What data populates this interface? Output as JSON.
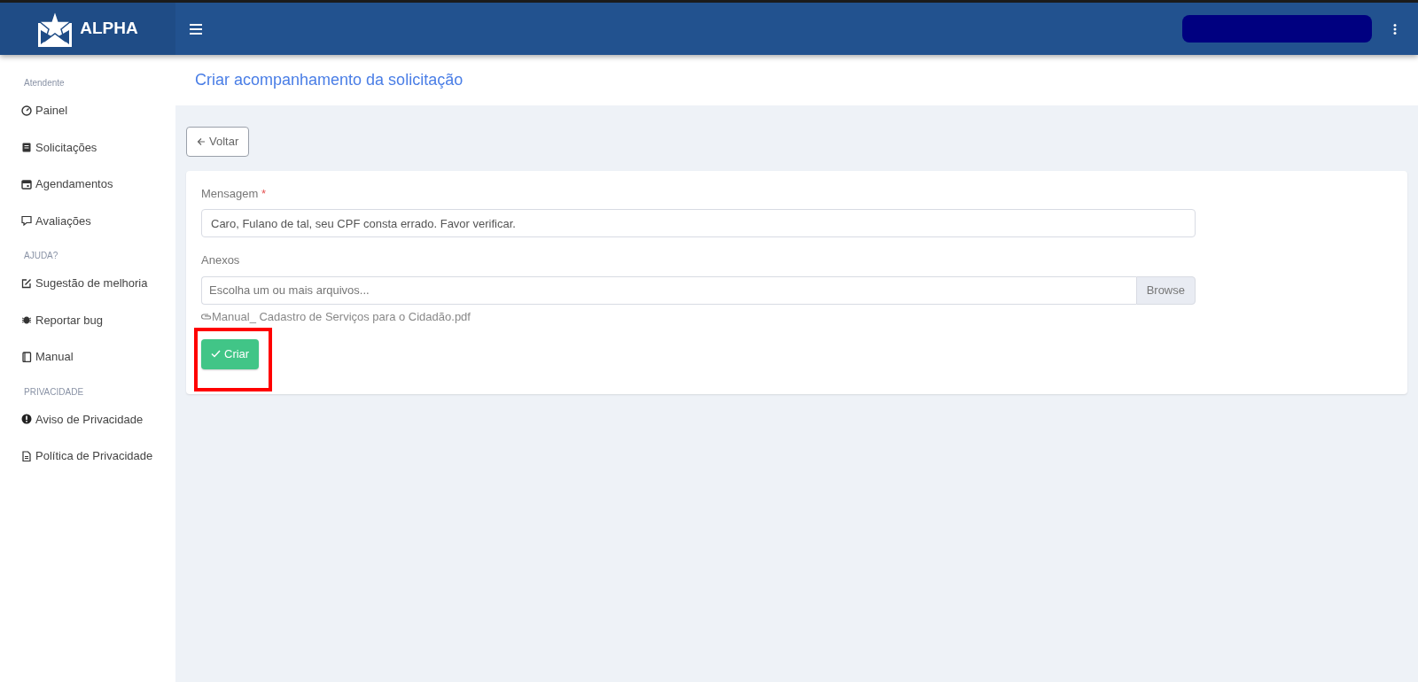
{
  "brand": {
    "name": "ALPHA"
  },
  "sidebar": {
    "sections": [
      {
        "title": "Atendente",
        "items": [
          {
            "label": "Painel",
            "kind": "gauge"
          },
          {
            "label": "Solicitações",
            "kind": "clipboard"
          },
          {
            "label": "Agendamentos",
            "kind": "calendar"
          },
          {
            "label": "Avaliações",
            "kind": "comment"
          }
        ]
      },
      {
        "title": "AJUDA?",
        "items": [
          {
            "label": "Sugestão de melhoria",
            "kind": "edit"
          },
          {
            "label": "Reportar bug",
            "kind": "bug"
          },
          {
            "label": "Manual",
            "kind": "book"
          }
        ]
      },
      {
        "title": "PRIVACIDADE",
        "items": [
          {
            "label": "Aviso de Privacidade",
            "kind": "alert"
          },
          {
            "label": "Política de Privacidade",
            "kind": "file"
          }
        ]
      }
    ]
  },
  "page": {
    "title": "Criar acompanhamento da solicitação",
    "back_button": "Voltar"
  },
  "form": {
    "message": {
      "label": "Mensagem",
      "required_mark": "*",
      "value": "Caro, Fulano de tal, seu CPF consta errado. Favor verificar."
    },
    "attachments": {
      "label": "Anexos",
      "placeholder": "Escolha um ou mais arquivos...",
      "browse_button": "Browse",
      "files": [
        "Manual_ Cadastro de Serviços para o Cidadão.pdf"
      ]
    },
    "submit_button": "Criar"
  }
}
